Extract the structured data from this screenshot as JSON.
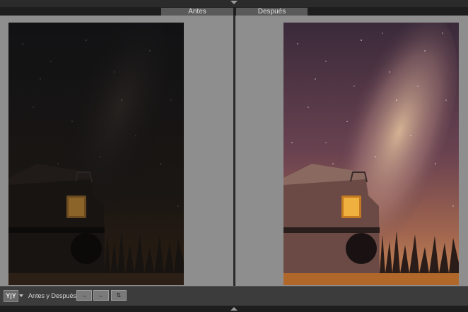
{
  "compare_view": {
    "before_label": "Antes",
    "after_label": "Después"
  },
  "toolbar": {
    "view_mode_label": "Y|Y",
    "before_after_label": "Antes y Después:",
    "copy_before_to_after_symbol": "→",
    "copy_after_to_before_symbol": "←",
    "swap_symbol": "⇅"
  },
  "photo_content": {
    "before_tone": "dark",
    "after_tone": "edited-warm"
  }
}
